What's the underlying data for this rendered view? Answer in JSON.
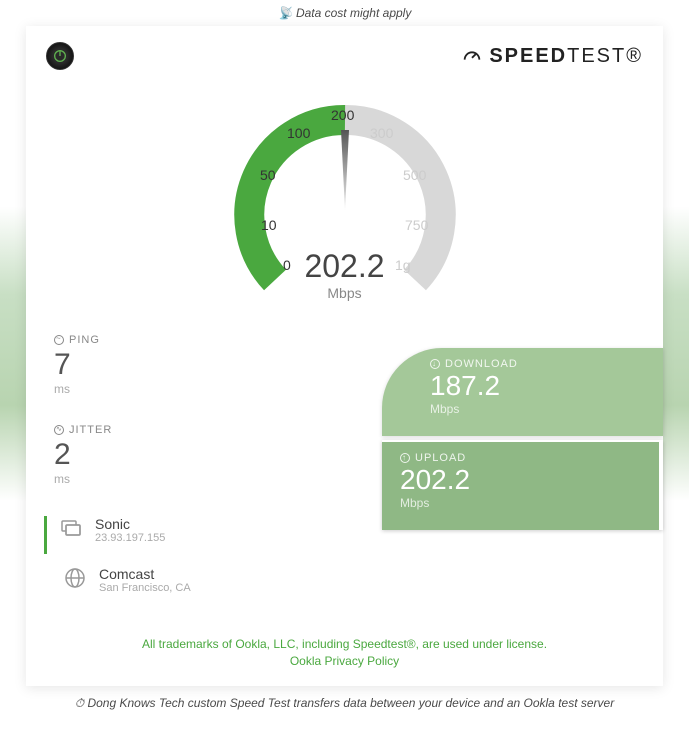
{
  "top_notice": "Data cost might apply",
  "brand": {
    "prefix": "SPEED",
    "suffix": "TEST"
  },
  "gauge": {
    "ticks_active": [
      "0",
      "10",
      "50",
      "100",
      "200"
    ],
    "ticks_inactive": [
      "300",
      "500",
      "750",
      "1g"
    ],
    "value": "202.2",
    "unit": "Mbps"
  },
  "ping": {
    "label": "PING",
    "value": "7",
    "unit": "ms"
  },
  "jitter": {
    "label": "JITTER",
    "value": "2",
    "unit": "ms"
  },
  "download": {
    "label": "DOWNLOAD",
    "value": "187.2",
    "unit": "Mbps"
  },
  "upload": {
    "label": "UPLOAD",
    "value": "202.2",
    "unit": "Mbps"
  },
  "isp": {
    "name": "Sonic",
    "ip": "23.93.197.155"
  },
  "server": {
    "name": "Comcast",
    "location": "San Francisco, CA"
  },
  "legal": {
    "line1": "All trademarks of Ookla, LLC, including Speedtest®, are used under license.",
    "line2": "Ookla Privacy Policy"
  },
  "bottom_notice": "Dong Knows Tech custom Speed Test transfers data between your device and an Ookla test server",
  "chart_data": {
    "type": "gauge",
    "title": "",
    "ticks": [
      0,
      10,
      50,
      100,
      200,
      300,
      500,
      750,
      1000
    ],
    "value": 202.2,
    "unit": "Mbps",
    "range": [
      0,
      1000
    ],
    "filled_to": 202.2
  }
}
